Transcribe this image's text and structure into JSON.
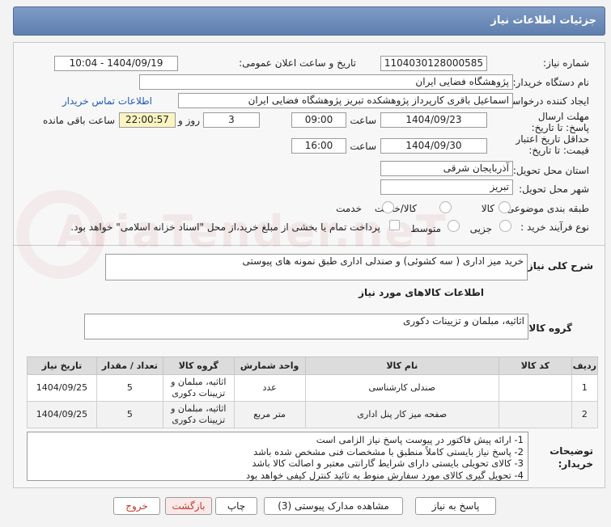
{
  "header": {
    "title": "جزئیات اطلاعات نیاز"
  },
  "form": {
    "need_number_label": "شماره نیاز:",
    "need_number": "1104030128000585",
    "announce_label": "تاریخ و ساعت اعلان عمومی:",
    "announce_value": "1404/09/19 - 10:04",
    "buyer_org_label": "نام دستگاه خریدار:",
    "buyer_org": "پژوهشگاه فضایی ایران",
    "creator_label": "ایجاد کننده درخواست:",
    "creator": "اسماعیل باقری کارپرداز پژوهشکده تبریز پژوهشگاه فضایی ایران",
    "contact_link": "اطلاعات تماس خریدار",
    "reply_deadline_label": "مهلت ارسال پاسخ: تا تاریخ:",
    "reply_date": "1404/09/23",
    "time_label": "ساعت",
    "reply_time": "09:00",
    "days_value": "3",
    "days_label": "روز و",
    "remaining_time": "22:00:57",
    "remaining_label": "ساعت باقی مانده",
    "validity_label": "حداقل تاریخ اعتبار قیمت: تا تاریخ:",
    "validity_date": "1404/09/30",
    "validity_time": "16:00",
    "province_label": "استان محل تحویل:",
    "province": "آذربایجان شرقی",
    "city_label": "شهر محل تحویل:",
    "city": "تبریز",
    "category_label": "طبقه بندی موضوعی:",
    "category_options": [
      "کالا",
      "کالا/خدمت",
      "خدمت"
    ],
    "process_label": "نوع فرآیند خرید :",
    "process_options": [
      "جزیی",
      "متوسط"
    ],
    "payment_note": "پرداخت تمام یا بخشی از مبلغ خرید،از محل \"اسناد خزانه اسلامی\" خواهد بود."
  },
  "description": {
    "label": "شرح کلی نیاز:",
    "value": "خرید میز اداری ( سه کشوئی) و صندلی اداری طبق نمونه های پیوستی"
  },
  "goods": {
    "section_title": "اطلاعات کالاهای مورد نیاز",
    "group_label": "گروه کالا:",
    "group_value": "اثاثیه، مبلمان و تزیینات دکوری",
    "columns": [
      "ردیف",
      "کد کالا",
      "نام کالا",
      "واحد شمارش",
      "گروه کالا",
      "تعداد / مقدار",
      "تاریخ نیاز"
    ],
    "rows": [
      {
        "idx": "1",
        "code": "",
        "name": "صندلی کارشناسی",
        "unit": "عدد",
        "group": "اثاثیه، مبلمان و تزیینات دکوری",
        "qty": "5",
        "date": "1404/09/25"
      },
      {
        "idx": "2",
        "code": "",
        "name": "صفحه میز کار پنل اداری",
        "unit": "متر مربع",
        "group": "اثاثیه، مبلمان و تزیینات دکوری",
        "qty": "5",
        "date": "1404/09/25"
      }
    ]
  },
  "notes": {
    "label": "توضیحات خریدار:",
    "lines": [
      "1- ارائه پیش فاکتور در پیوست پاسخ نیاز الزامی است",
      "2- پاسخ نیاز بایستی کاملاً منطبق با مشخصات فنی مشخص شده باشد",
      "3- کالای تحویلی بایستی دارای شرایط گارانتی معتبر و اصالت کالا باشد",
      "4- تحویل گیری کالای مورد سفارش منوط به تائید کنترل کیفی خواهد بود"
    ]
  },
  "buttons": {
    "reply": "پاسخ به نیاز",
    "attachments": "مشاهده مدارک پیوستی (3)",
    "print": "چاپ",
    "back": "بازگشت",
    "exit": "خروج"
  },
  "watermark": "AriaTender.neT",
  "colors": {
    "header": "#6a88b8",
    "link": "#1f5bb5",
    "remaining_bg": "#fbf4c1",
    "exit_text": "#c0392b"
  }
}
